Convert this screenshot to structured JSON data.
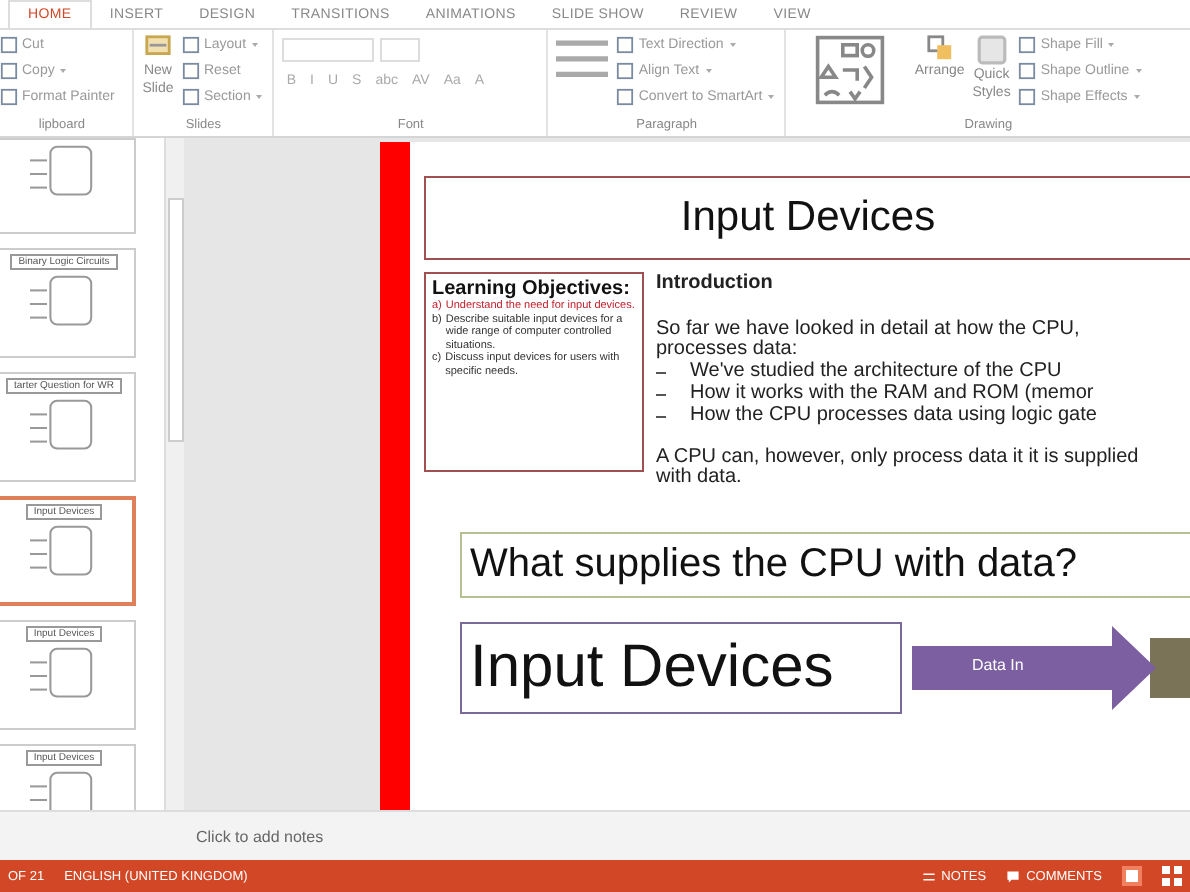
{
  "ribbon": {
    "tabs": [
      {
        "label": "HOME",
        "selected": true
      },
      {
        "label": "INSERT",
        "selected": false
      },
      {
        "label": "DESIGN",
        "selected": false
      },
      {
        "label": "TRANSITIONS",
        "selected": false
      },
      {
        "label": "ANIMATIONS",
        "selected": false
      },
      {
        "label": "SLIDE SHOW",
        "selected": false
      },
      {
        "label": "REVIEW",
        "selected": false
      },
      {
        "label": "VIEW",
        "selected": false
      }
    ],
    "clipboard": {
      "label": "lipboard",
      "buttons": [
        "Cut",
        "Copy",
        "Format Painter"
      ]
    },
    "slides": {
      "label": "Slides",
      "new_slide": [
        "New",
        "Slide"
      ],
      "buttons": [
        "Layout",
        "Reset",
        "Section"
      ]
    },
    "font": {
      "label": "Font",
      "format_buttons": [
        "B",
        "I",
        "U",
        "S",
        "abc",
        "AV",
        "Aa",
        "A"
      ]
    },
    "paragraph": {
      "label": "Paragraph",
      "buttons": [
        "Text Direction",
        "Align Text",
        "Convert to SmartArt"
      ]
    },
    "drawing": {
      "label": "Drawing",
      "arrange": "Arrange",
      "quick_styles": [
        "Quick",
        "Styles"
      ],
      "buttons": [
        "Shape Fill",
        "Shape Outline",
        "Shape Effects"
      ]
    }
  },
  "thumbnails": [
    {
      "selected": false
    },
    {
      "title": "Binary Logic Circuits",
      "selected": false
    },
    {
      "title": "tarter Question for WR",
      "selected": false
    },
    {
      "title": "Input Devices",
      "selected": true
    },
    {
      "title": "Input Devices",
      "selected": false
    },
    {
      "title": "Input Devices",
      "selected": false
    }
  ],
  "slide": {
    "title": "Input Devices",
    "objectives": {
      "heading": "Learning Objectives:",
      "items": [
        {
          "marker": "a)",
          "text": "Understand the need for input devices.",
          "highlighted": true
        },
        {
          "marker": "b)",
          "text": "Describe suitable input devices for a wide range of computer controlled situations.",
          "highlighted": false
        },
        {
          "marker": "c)",
          "text": "Discuss input devices for users with specific needs.",
          "highlighted": false
        }
      ]
    },
    "intro": {
      "heading": "Introduction",
      "lead": "So far we have looked in detail at how the CPU, processes data:",
      "bullets": [
        "We've studied the architecture of the CPU",
        "How it works with the RAM and ROM (memor",
        "How the CPU processes data using logic gate"
      ],
      "closing": "A CPU can, however, only process data it it is supplied with data."
    },
    "question": "What supplies the CPU with data?",
    "answer": "Input Devices",
    "arrow_label": "Data In"
  },
  "notes_placeholder": "Click to add notes",
  "status_bar": {
    "slide_info": "OF 21",
    "language": "ENGLISH (UNITED KINGDOM)",
    "notes": "NOTES",
    "comments": "COMMENTS"
  }
}
